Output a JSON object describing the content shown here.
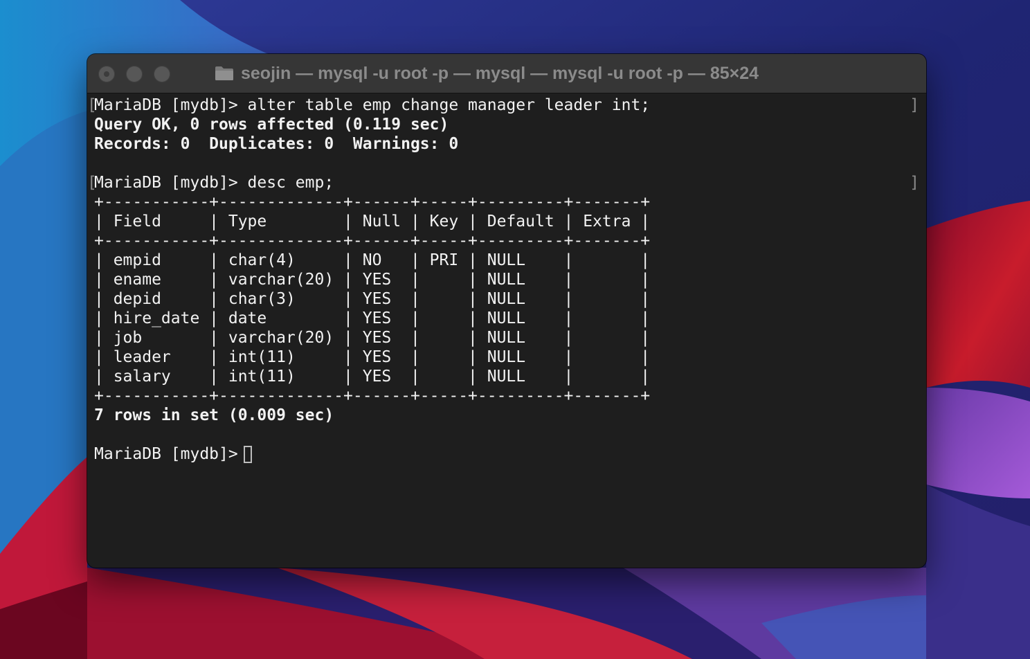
{
  "window": {
    "title": "seojin — mysql -u root -p — mysql — mysql -u root -p — 85×24"
  },
  "terminal": {
    "lines": [
      {
        "text": "MariaDB [mydb]> alter table emp change manager leader int;",
        "bold": false,
        "mark": true
      },
      {
        "text": "Query OK, 0 rows affected (0.119 sec)",
        "bold": true
      },
      {
        "text": "Records: 0  Duplicates: 0  Warnings: 0",
        "bold": true
      },
      {
        "text": "",
        "bold": false
      },
      {
        "text": "MariaDB [mydb]> desc emp;",
        "bold": false,
        "mark": true
      },
      {
        "text": "+-----------+-------------+------+-----+---------+-------+",
        "bold": false
      },
      {
        "text": "| Field     | Type        | Null | Key | Default | Extra |",
        "bold": false
      },
      {
        "text": "+-----------+-------------+------+-----+---------+-------+",
        "bold": false
      },
      {
        "text": "| empid     | char(4)     | NO   | PRI | NULL    |       |",
        "bold": false
      },
      {
        "text": "| ename     | varchar(20) | YES  |     | NULL    |       |",
        "bold": false
      },
      {
        "text": "| depid     | char(3)     | YES  |     | NULL    |       |",
        "bold": false
      },
      {
        "text": "| hire_date | date        | YES  |     | NULL    |       |",
        "bold": false
      },
      {
        "text": "| job       | varchar(20) | YES  |     | NULL    |       |",
        "bold": false
      },
      {
        "text": "| leader    | int(11)     | YES  |     | NULL    |       |",
        "bold": false
      },
      {
        "text": "| salary    | int(11)     | YES  |     | NULL    |       |",
        "bold": false
      },
      {
        "text": "+-----------+-------------+------+-----+---------+-------+",
        "bold": false
      },
      {
        "text": "7 rows in set (0.009 sec)",
        "bold": true
      },
      {
        "text": "",
        "bold": false
      }
    ],
    "prompt": "MariaDB [mydb]> ",
    "mark_left": "[",
    "mark_right": "]"
  },
  "colors": {
    "terminal_background": "#1e1e1e",
    "terminal_text": "#f2f2f2",
    "titlebar": "#363636",
    "title_text": "#8b8b8b"
  },
  "icons": {
    "folder": "folder-icon",
    "close": "close-button",
    "minimize": "minimize-button",
    "zoom": "zoom-button"
  }
}
